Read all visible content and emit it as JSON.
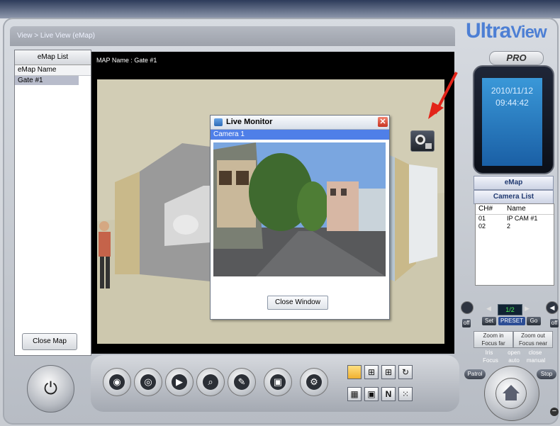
{
  "app": {
    "breadcrumb": "View > Live View (eMap)",
    "brand": {
      "logo_main": "Ultra",
      "logo_suffix": "View",
      "edition": "PRO"
    }
  },
  "left_panel": {
    "header": "eMap List",
    "column_header": "eMap Name",
    "items": [
      "Gate #1"
    ],
    "close_map_label": "Close Map"
  },
  "map": {
    "name_label": "MAP Name : Gate #1"
  },
  "live_monitor": {
    "title": "Live Monitor",
    "camera_label": "Camera 1",
    "close_window_label": "Close Window"
  },
  "clock": {
    "date": "2010/11/12",
    "time": "09:44:42"
  },
  "right_nav": {
    "emap_label": "eMap",
    "camera_list_label": "Camera List"
  },
  "camera_list": {
    "columns": [
      "CH#",
      "Name"
    ],
    "rows": [
      {
        "ch": "01",
        "name": "IP CAM #1"
      },
      {
        "ch": "02",
        "name": "2"
      }
    ]
  },
  "ptz": {
    "counter": "1/2",
    "set_label": "Set",
    "preset_label": "PRESET",
    "go_label": "Go",
    "zoom_in_label": "Zoom in",
    "focus_far_label": "Focus far",
    "zoom_out_label": "Zoom out",
    "focus_near_label": "Focus near",
    "iris_label": "Iris",
    "open_label": "open",
    "close_label": "close",
    "focus_label": "Focus",
    "auto_label": "auto",
    "manual_label": "manual",
    "patrol_label": "Patrol",
    "stop_label": "Stop",
    "off_label": "off"
  },
  "bottom_controls": {
    "icons": [
      "record-icon",
      "live-view-icon",
      "playback-icon",
      "search-icon",
      "edit-icon",
      "backup-icon",
      "settings-icon"
    ],
    "layout_buttons": [
      "layout-1",
      "layout-4",
      "layout-9",
      "layout-rotate",
      "layout-16",
      "layout-single-b",
      "layout-n",
      "layout-grid"
    ]
  },
  "colors": {
    "accent_blue": "#4f7fe8",
    "clock_blue": "#2f86cc",
    "arrow_red": "#e32419"
  }
}
